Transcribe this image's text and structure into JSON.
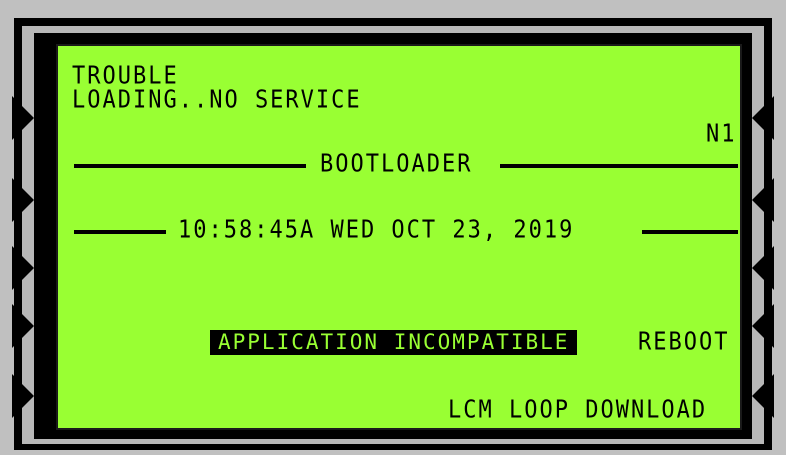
{
  "status": {
    "line1": "TROUBLE",
    "line2": "LOADING..NO SERVICE",
    "node": "N1"
  },
  "header": {
    "title": "BOOTLOADER",
    "datetime": "10:58:45A WED OCT 23, 2019"
  },
  "messages": {
    "application": "APPLICATION INCOMPATIBLE",
    "reboot": "REBOOT",
    "download": "LCM LOOP DOWNLOAD"
  },
  "colors": {
    "lcd_background": "#99ff33",
    "lcd_text": "#000000",
    "bezel": "#c0c0c0"
  }
}
